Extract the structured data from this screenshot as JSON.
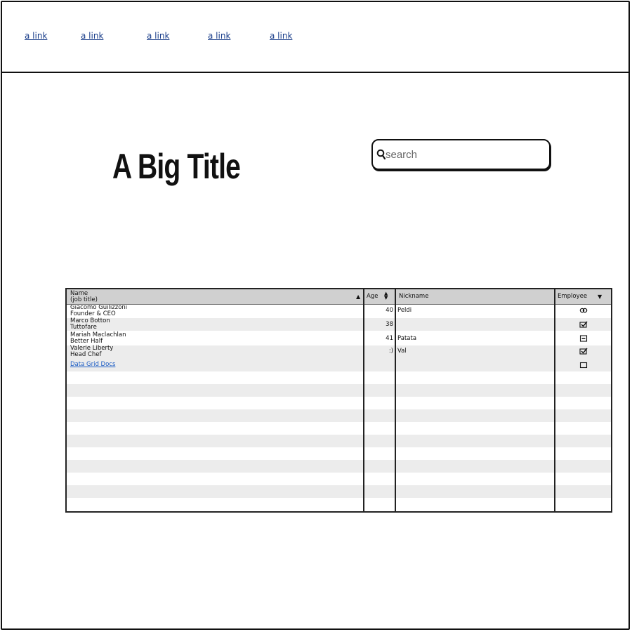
{
  "nav": {
    "links": [
      {
        "label": "a link"
      },
      {
        "label": "a link"
      },
      {
        "label": "a link"
      },
      {
        "label": "a link"
      },
      {
        "label": "a link"
      }
    ]
  },
  "main": {
    "title": "A Big Title",
    "search": {
      "placeholder": "search",
      "value": ""
    }
  },
  "grid": {
    "columns": {
      "name": {
        "line1": "Name",
        "line2": "(job title)"
      },
      "age": "Age",
      "nickname": "Nickname",
      "employee": "Employee"
    },
    "rows": [
      {
        "name": "Giacomo Guilizzoni",
        "title": "Founder & CEO",
        "age": "40",
        "nickname": "Peldi",
        "employee": "partial-icon"
      },
      {
        "name": "Marco Botton",
        "title": "Tuttofare",
        "age": "38",
        "nickname": "",
        "employee": "checked-icon"
      },
      {
        "name": "Mariah Maclachlan",
        "title": "Better Half",
        "age": "41",
        "nickname": "Patata",
        "employee": "indeterminate-icon"
      },
      {
        "name": "Valerie Liberty",
        "title": "Head Chef",
        "age": ":)",
        "nickname": "Val",
        "employee": "checked-icon"
      }
    ],
    "docs_link": "Data Grid Docs",
    "docs_employee": "unchecked-icon"
  }
}
